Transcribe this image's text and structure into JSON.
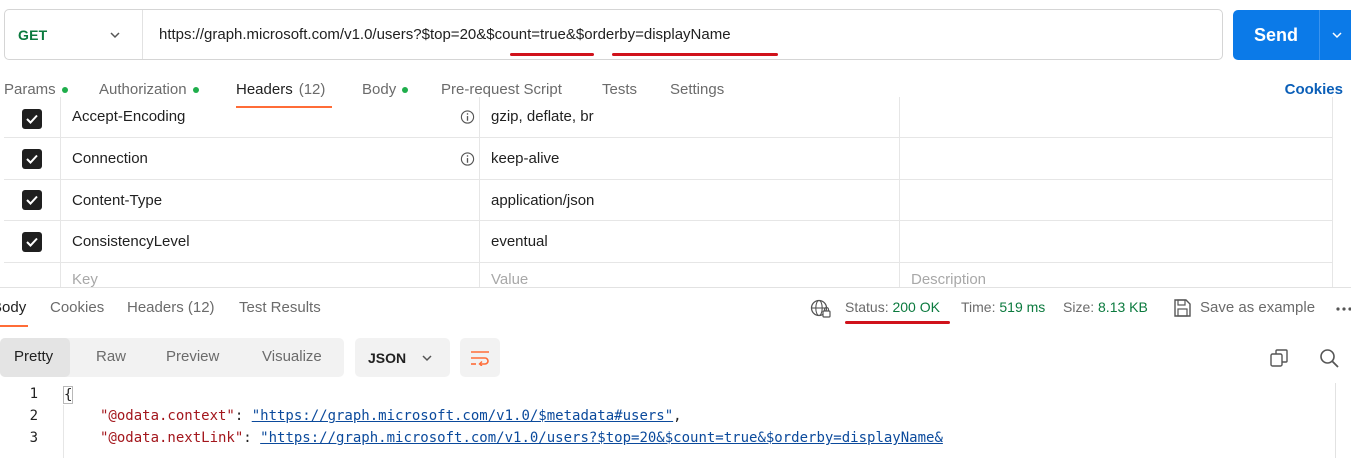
{
  "request": {
    "method": "GET",
    "url": "https://graph.microsoft.com/v1.0/users?$top=20&$count=true&$orderby=displayName",
    "send_label": "Send"
  },
  "request_tabs": [
    {
      "label": "Params",
      "dot": true
    },
    {
      "label": "Authorization",
      "dot": true
    },
    {
      "label": "Headers",
      "count": "(12)",
      "active": true
    },
    {
      "label": "Body",
      "dot": true
    },
    {
      "label": "Pre-request Script"
    },
    {
      "label": "Tests"
    },
    {
      "label": "Settings"
    }
  ],
  "cookies_link": "Cookies",
  "headers": [
    {
      "key": "Accept-Encoding",
      "value": "gzip, deflate, br",
      "checked": true,
      "info": true
    },
    {
      "key": "Connection",
      "value": "keep-alive",
      "checked": true,
      "info": true
    },
    {
      "key": "Content-Type",
      "value": "application/json",
      "checked": true,
      "info": false
    },
    {
      "key": "ConsistencyLevel",
      "value": "eventual",
      "checked": true,
      "info": false
    }
  ],
  "header_placeholders": {
    "key": "Key",
    "value": "Value",
    "description": "Description"
  },
  "response_tabs": [
    {
      "label": "Body",
      "active": true
    },
    {
      "label": "Cookies"
    },
    {
      "label": "Headers (12)"
    },
    {
      "label": "Test Results"
    }
  ],
  "response_meta": {
    "status_label": "Status:",
    "status_value": "200 OK",
    "time_label": "Time:",
    "time_value": "519 ms",
    "size_label": "Size:",
    "size_value": "8.13 KB",
    "save_example": "Save as example"
  },
  "view_modes": [
    "Pretty",
    "Raw",
    "Preview",
    "Visualize"
  ],
  "format": "JSON",
  "code_lines": [
    {
      "n": "1",
      "text": "{"
    },
    {
      "n": "2",
      "key": "\"@odata.context\"",
      "sep": ": ",
      "val": "\"https://graph.microsoft.com/v1.0/$metadata#users\"",
      "tail": ","
    },
    {
      "n": "3",
      "key": "\"@odata.nextLink\"",
      "sep": ": ",
      "val": "\"https://graph.microsoft.com/v1.0/users?$top=20&$count=true&$orderby=displayName&",
      "tail": ""
    }
  ],
  "colors": {
    "accent": "#ff6c37",
    "send": "#0b7ae8",
    "ok": "#0b7a3e",
    "annotation": "#d0121b"
  }
}
